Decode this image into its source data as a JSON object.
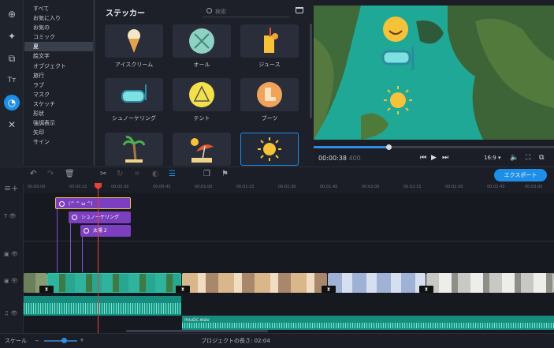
{
  "lefttools": [
    {
      "icon": "import-icon",
      "glyph": "⊕"
    },
    {
      "icon": "magic-wand-icon",
      "glyph": "✦"
    },
    {
      "icon": "transitions-icon",
      "glyph": "⧉"
    },
    {
      "icon": "titles-icon",
      "glyph": "Tт"
    },
    {
      "icon": "stickers-icon",
      "glyph": "◔"
    },
    {
      "icon": "tools-icon",
      "glyph": "✕"
    }
  ],
  "categories": [
    "すべて",
    "お気に入り",
    "お気の",
    "コミック",
    "夏",
    "絵文字",
    "オブジェクト",
    "旅行",
    "ラブ",
    "マスク",
    "スケッチ",
    "形状",
    "強調表示",
    "矢印",
    "サイン"
  ],
  "selected_category": "夏",
  "stickers_title": "ステッカー",
  "search_placeholder": "検索",
  "tiles": [
    {
      "label": "アイスクリーム",
      "icon": "ice-cream-icon"
    },
    {
      "label": "オール",
      "icon": "oars-icon"
    },
    {
      "label": "ジュース",
      "icon": "juice-icon"
    },
    {
      "label": "シュノーケリング",
      "icon": "snorkel-icon"
    },
    {
      "label": "テント",
      "icon": "tent-icon"
    },
    {
      "label": "ブーツ",
      "icon": "boots-icon"
    },
    {
      "label": "",
      "icon": "palm-tree-icon"
    },
    {
      "label": "",
      "icon": "beach-umbrella-icon"
    },
    {
      "label": "",
      "icon": "sun-icon"
    }
  ],
  "time_current": "00:00:38",
  "time_extra": "400",
  "playback_progress": 0.32,
  "aspect": "16:9",
  "export_label": "エクスポート",
  "ruler": [
    "00:00:00",
    "00:00:15",
    "00:00:30",
    "00:00:45",
    "00:01:00",
    "00:01:15",
    "00:01:30",
    "00:01:45",
    "00:02:00",
    "00:02:15",
    "00:02:30",
    "00:02:45",
    "00:03:00"
  ],
  "clips": [
    {
      "label": "(^ ^ ω ^)"
    },
    {
      "label": "シュノーケリング"
    },
    {
      "label": "太陽 2"
    }
  ],
  "audio_label": "music.wav",
  "scale_label": "スケール",
  "project_length_label": "プロジェクトの長さ:",
  "project_length": "02:04",
  "colors": {
    "accent": "#1e8fe8",
    "clip": "#7b3fbf",
    "audio": "#168d7f",
    "playhead": "#e0453a"
  }
}
